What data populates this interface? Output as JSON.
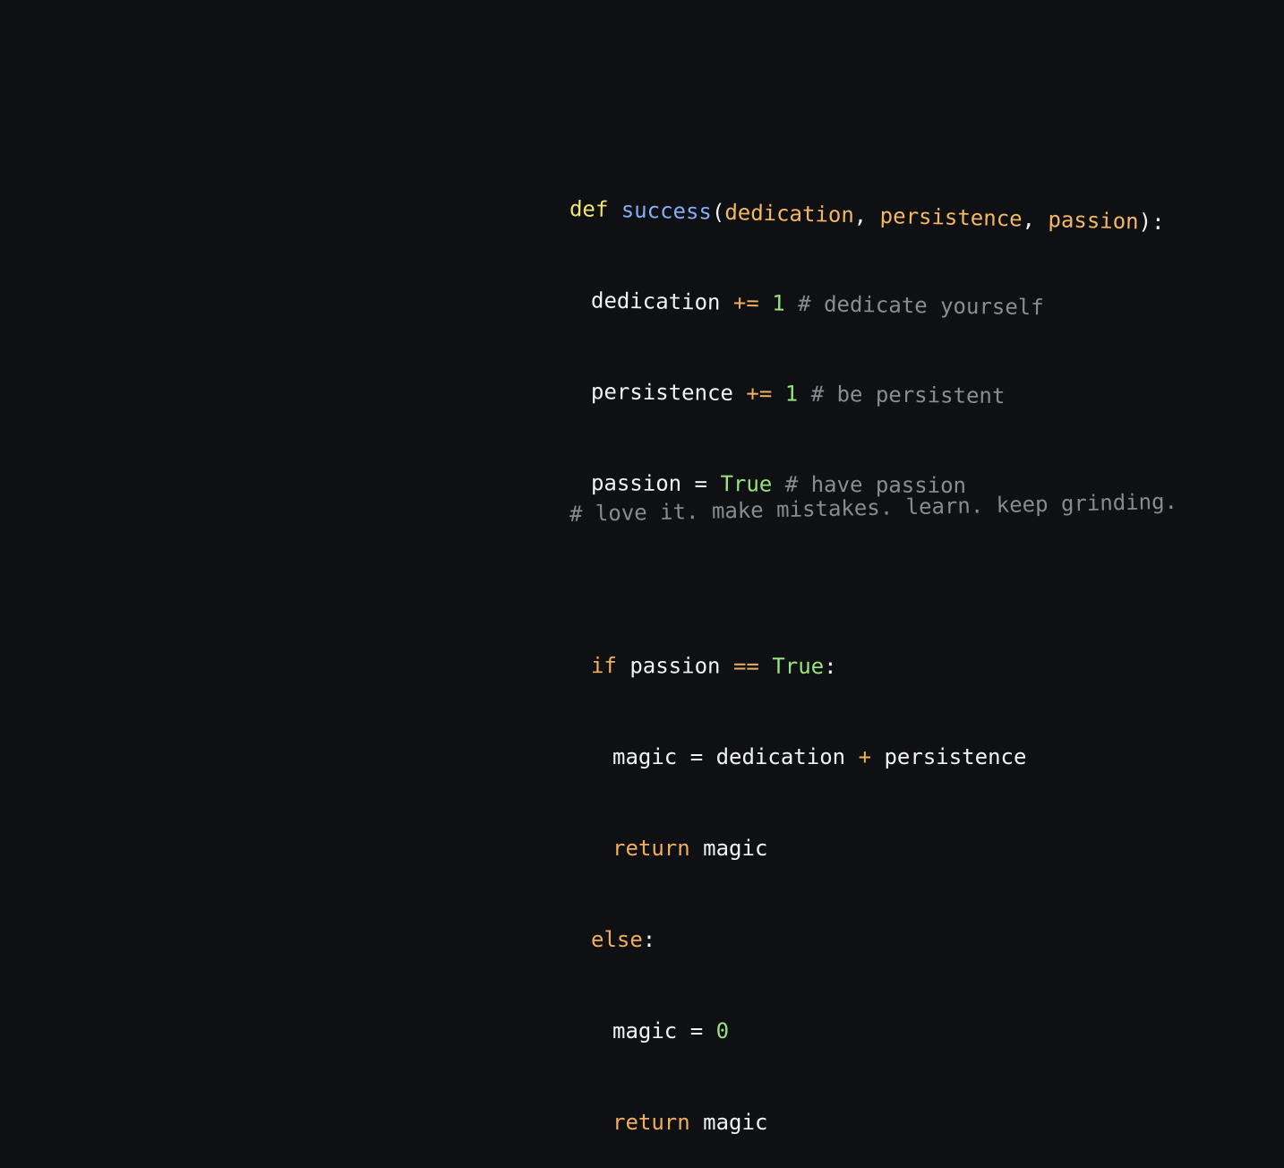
{
  "colors": {
    "background": "#0f1014",
    "keyword": "#f0ae5a",
    "def": "#efe571",
    "function": "#86adf2",
    "number": "#98e37a",
    "comment": "#8c8c8c",
    "text": "#f2f2f2"
  },
  "code": {
    "l0": {
      "def": "def",
      "fn": "success",
      "open": "(",
      "p1": "dedication",
      "c1": ", ",
      "p2": "persistence",
      "c2": ", ",
      "p3": "passion",
      "close": "):"
    },
    "l1": {
      "var": "dedication",
      "op": "+=",
      "num": "1",
      "cm": "# dedicate yourself"
    },
    "l2": {
      "var": "persistence",
      "op": "+=",
      "num": "1",
      "cm": "# be persistent"
    },
    "l3": {
      "var": "passion",
      "op": "=",
      "val": "True",
      "cm": "# have passion"
    },
    "l5": {
      "kw": "if",
      "var": "passion",
      "op": "==",
      "val": "True",
      "colon": ":"
    },
    "l6": {
      "var": "magic",
      "eq": "=",
      "a": "dedication",
      "op": "+",
      "b": "persistence"
    },
    "l7": {
      "kw": "return",
      "var": "magic"
    },
    "l8": {
      "kw": "else",
      "colon": ":"
    },
    "l9": {
      "var": "magic",
      "eq": "=",
      "num": "0"
    },
    "l10": {
      "kw": "return",
      "var": "magic"
    }
  },
  "footer": "# love it. make mistakes. learn. keep grinding."
}
